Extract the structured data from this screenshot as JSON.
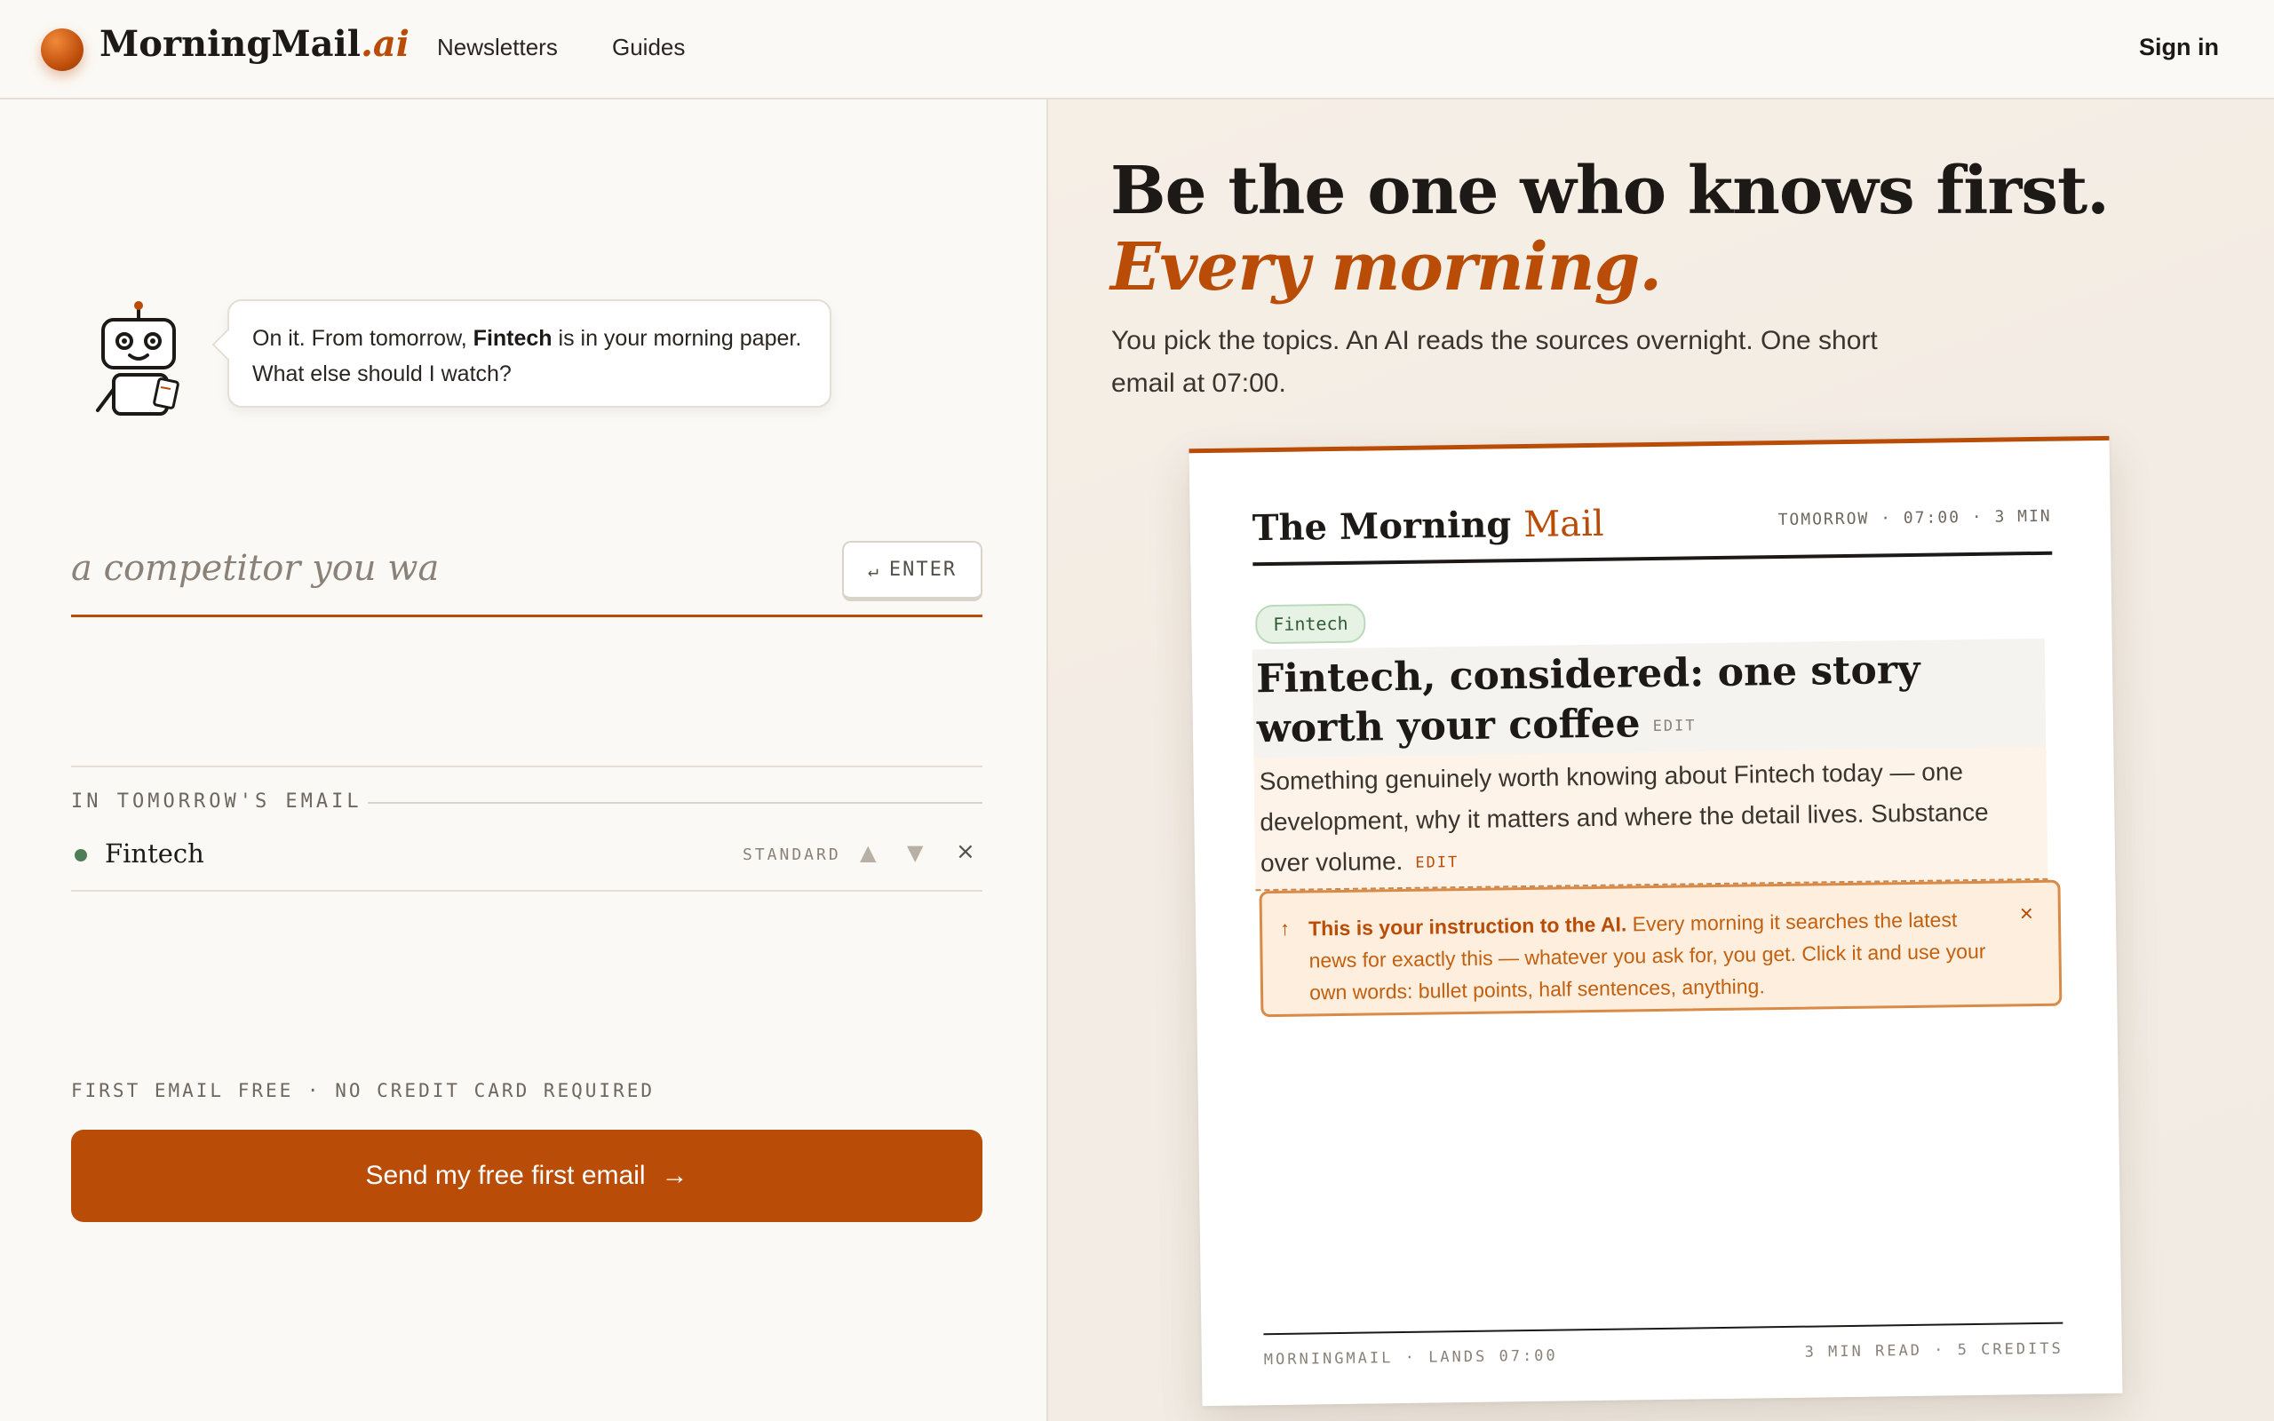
{
  "header": {
    "logo_main": "MorningMail",
    "logo_suffix": ".ai",
    "nav": [
      "Newsletters",
      "Guides"
    ],
    "signin": "Sign in"
  },
  "assistant": {
    "bubble_pre": "On it. From tomorrow, ",
    "bubble_topic": "Fintech",
    "bubble_post": " is in your morning paper. What else should I watch?"
  },
  "input": {
    "value": "a competitor you wa",
    "enter_symbol": "↵",
    "enter_label": "ENTER"
  },
  "topics": {
    "section_label": "IN TOMORROW'S EMAIL",
    "items": [
      {
        "name": "Fintech",
        "level": "STANDARD",
        "up_icon": "▲",
        "down_icon": "▼",
        "remove_icon": "×"
      }
    ]
  },
  "cta": {
    "footnote": "FIRST EMAIL FREE · NO CREDIT CARD REQUIRED",
    "label": "Send my free first email",
    "arrow": "→"
  },
  "hero": {
    "headline_a": "Be the one who knows first. ",
    "headline_b": "Every morning.",
    "subheadline": "You pick the topics. An AI reads the sources overnight. One short email at 07:00."
  },
  "preview": {
    "title_a": "The Morning ",
    "title_b": "Mail",
    "meta": "TOMORROW · 07:00 · 3 MIN",
    "tag": "Fintech",
    "story_title": "Fintech, considered: one story worth your coffee",
    "edit": "EDIT",
    "story_body": "Something genuinely worth knowing about Fintech today — one development, why it matters and where the detail lives. Substance over volume.",
    "hint_icon": "↑",
    "hint_bold": "This is your instruction to the AI.",
    "hint_text": " Every morning it searches the latest news for exactly this — whatever you ask for, you get. Click it and use your own words: bullet points, half sentences, anything.",
    "hint_close": "×",
    "footer_left": "MORNINGMAIL · LANDS 07:00",
    "footer_right": "3 MIN READ · 5 CREDITS"
  },
  "colors": {
    "accent": "#b94c06",
    "background": "#fbf9f5",
    "tag_green": "#e6f2e4"
  }
}
